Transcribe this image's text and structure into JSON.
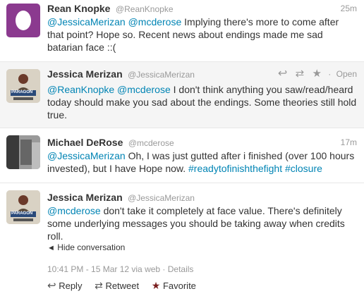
{
  "tweets": [
    {
      "name": "Rean Knopke",
      "handle": "@ReanKnopke",
      "time": "25m",
      "mentions": "@JessicaMerizan @mcderose",
      "text": " Implying there's more to come after that point? Hope so. Recent news about endings made me sad batarian face ::("
    },
    {
      "name": "Jessica Merizan",
      "handle": "@JessicaMerizan",
      "open_label": "Open",
      "mentions": "@ReanKnopke @mcderose",
      "text": " I don't think anything you saw/read/heard today should make you sad about the endings. Some theories still hold true.",
      "avatar_label": "PARAGON"
    },
    {
      "name": "Michael DeRose",
      "handle": "@mcderose",
      "time": "17m",
      "mentions": "@JessicaMerizan",
      "text": " Oh, I was just gutted after i finished (over 100 hours invested), but I have Hope now. ",
      "hashtag1": "#readytofinishthefight",
      "hashtag2": "#closure"
    },
    {
      "name": "Jessica Merizan",
      "handle": "@JessicaMerizan",
      "mentions": "@mcderose",
      "text": " don't take it completely at face value. There's definitely some underlying messages you should be taking away when credits roll.",
      "hide_label": "Hide conversation",
      "meta_text": "10:41 PM - 15 Mar 12 via web · ",
      "details_label": "Details",
      "reply_label": "Reply",
      "retweet_label": "Retweet",
      "favorite_label": "Favorite",
      "avatar_label": "PARAGON"
    }
  ],
  "colors": {
    "link": "#0084b4",
    "egg_bg": "#8b3a8f",
    "star": "#7a1f1f"
  },
  "icons": [
    "egg-icon",
    "reply-icon",
    "retweet-icon",
    "star-icon"
  ]
}
